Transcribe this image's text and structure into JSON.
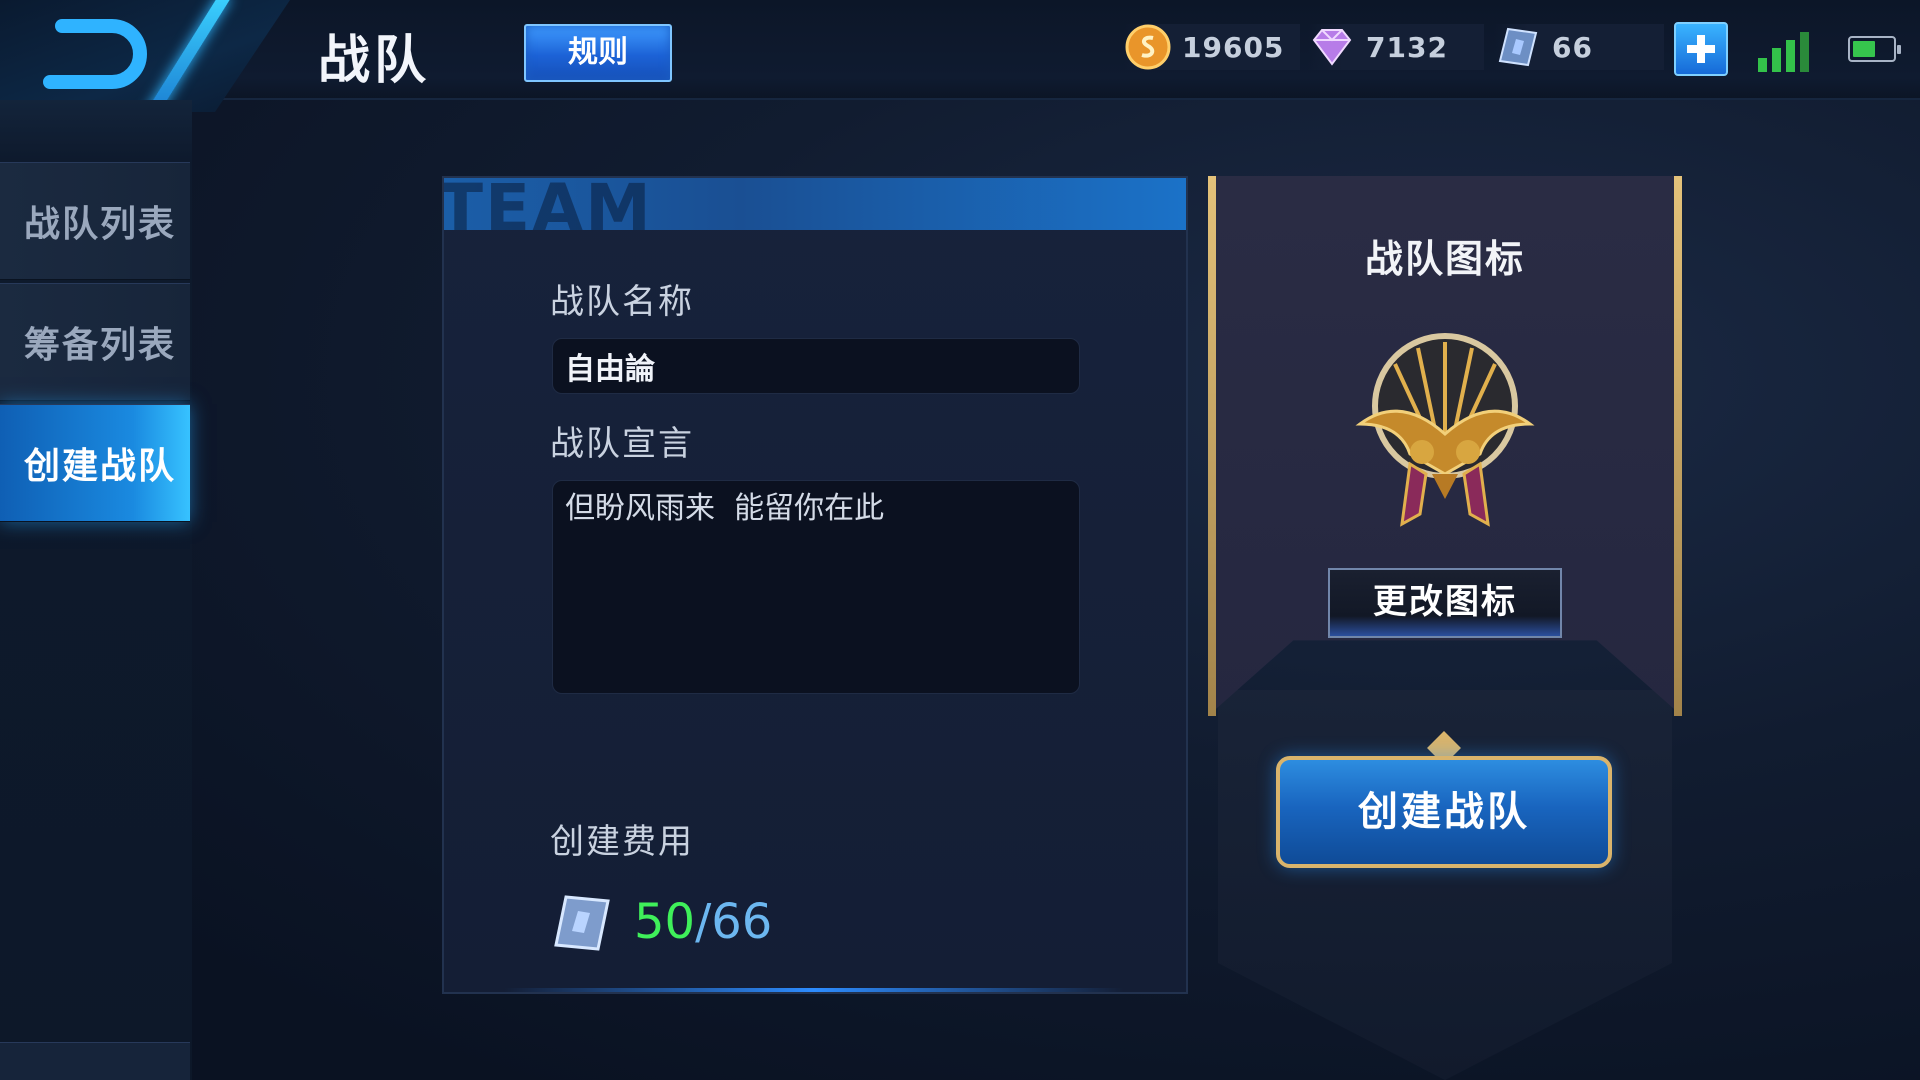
{
  "header": {
    "title": "战队",
    "rules_label": "规则"
  },
  "currencies": [
    {
      "icon": "gold-coin-icon",
      "value": "19605"
    },
    {
      "icon": "diamond-icon",
      "value": "7132"
    },
    {
      "icon": "crystal-voucher-icon",
      "value": "66"
    }
  ],
  "sidebar": {
    "items": [
      {
        "label": "战队列表",
        "active": false
      },
      {
        "label": "筹备列表",
        "active": false
      },
      {
        "label": "创建战队",
        "active": true
      }
    ]
  },
  "form": {
    "header_watermark": "TEAM",
    "name_label": "战队名称",
    "name_value": "自由論",
    "declaration_label": "战队宣言",
    "declaration_value": "但盼风雨来  能留你在此",
    "cost_label": "创建费用",
    "cost_current": "50",
    "cost_separator": "/",
    "cost_max": "66"
  },
  "emblem": {
    "title": "战队图标",
    "change_label": "更改图标"
  },
  "actions": {
    "create_label": "创建战队"
  },
  "colors": {
    "accent_blue": "#1a8ae0",
    "gold_trim": "#d9b46c",
    "cost_ok_green": "#3ff05a"
  }
}
